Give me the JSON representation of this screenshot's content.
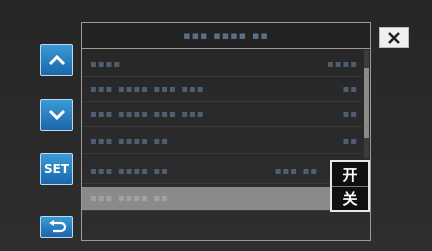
{
  "header": {
    "title": "▪▪▪ ▪▪▪▪ ▪▪"
  },
  "nav": {
    "set_label": "SET"
  },
  "rows": [
    {
      "label": "▪▪▪▪",
      "value": "▪▪▪▪"
    },
    {
      "label": "▪▪▪ ▪▪▪▪ ▪▪▪ ▪▪▪",
      "value": "▪▪"
    },
    {
      "label": "▪▪▪ ▪▪▪▪ ▪▪▪ ▪▪▪",
      "value": "▪▪"
    },
    {
      "label": "▪▪▪ ▪▪▪▪ ▪▪",
      "value": "▪▪"
    },
    {
      "label": "▪▪▪ ▪▪▪▪ ▪▪",
      "value": "▪▪▪ ▪▪"
    },
    {
      "label": "▪▪▪ ▪▪▪▪ ▪▪",
      "value": ""
    }
  ],
  "popup": {
    "on_label": "开",
    "off_label": "关"
  },
  "colors": {
    "button_blue": "#1b66aa",
    "selected_row": "#8a8a8a"
  }
}
